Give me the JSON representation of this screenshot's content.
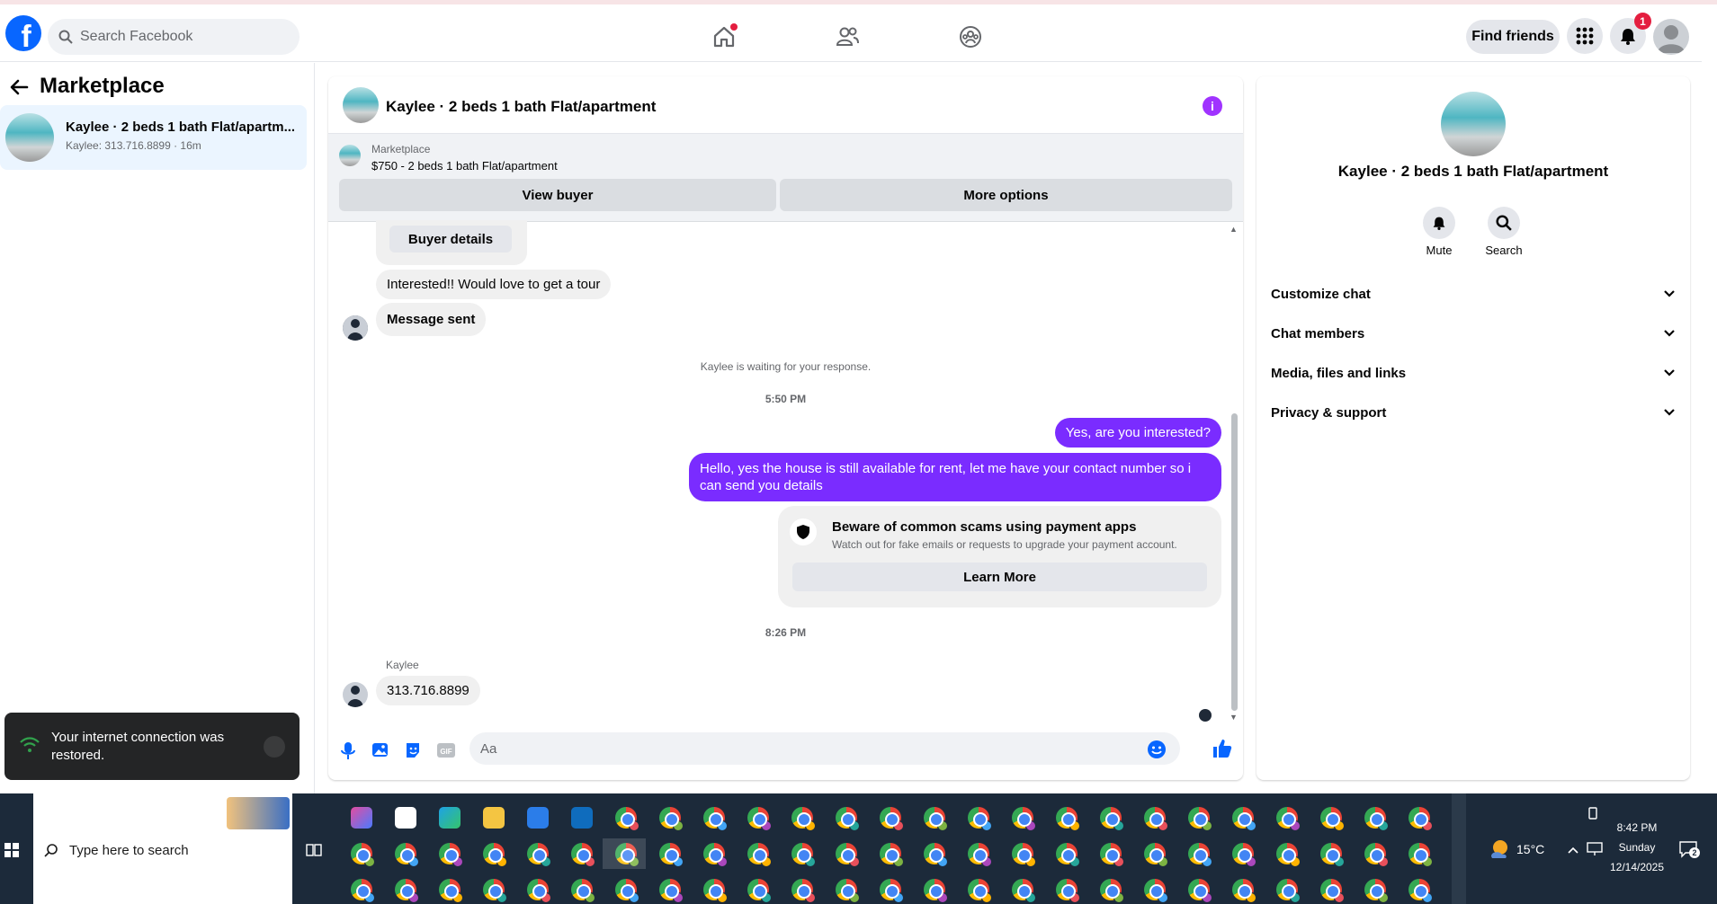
{
  "topbar": {
    "logo": "f",
    "search_placeholder": "Search Facebook",
    "find_friends": "Find friends",
    "notification_count": "1"
  },
  "left": {
    "title": "Marketplace",
    "listing": {
      "title": "Kaylee · 2 beds 1 bath Flat/apartm...",
      "subtitle": "Kaylee: 313.716.8899 · 16m"
    }
  },
  "chat": {
    "title": "Kaylee · 2 beds 1 bath Flat/apartment",
    "marketplace_label": "Marketplace",
    "marketplace_price": "$750 - 2 beds 1 bath Flat/apartment",
    "view_buyer": "View buyer",
    "more_options": "More options",
    "buyer_details": "Buyer details",
    "msg_interested": "Interested!! Would love to get a tour",
    "msg_sent": "Message sent",
    "waiting": "Kaylee is waiting for your response.",
    "time1": "5:50 PM",
    "out1": "Yes, are you interested?",
    "out2": "Hello, yes the house is still available for rent, let me have your contact number so i can send you details",
    "scam_title": "Beware of common scams using payment apps",
    "scam_sub": "Watch out for fake emails or requests to upgrade your payment account.",
    "learn_more": "Learn More",
    "time2": "8:26 PM",
    "sender_name": "Kaylee",
    "msg_phone": "313.716.8899",
    "composer_placeholder": "Aa"
  },
  "right": {
    "title": "Kaylee · 2 beds 1 bath Flat/apartment",
    "mute": "Mute",
    "search": "Search",
    "rows": [
      "Customize chat",
      "Chat members",
      "Media, files and links",
      "Privacy & support"
    ]
  },
  "toast": {
    "text": "Your internet connection was restored."
  },
  "taskbar": {
    "search_placeholder": "Type here to search",
    "weather": "15°C",
    "time": "8:42 PM",
    "day": "Sunday",
    "date": "12/14/2025",
    "notif_count": "2"
  },
  "colors": {
    "accent": "#0866ff",
    "bubble_out": "#7a2cff",
    "info": "#a033ff",
    "badge": "#e41e3f"
  }
}
